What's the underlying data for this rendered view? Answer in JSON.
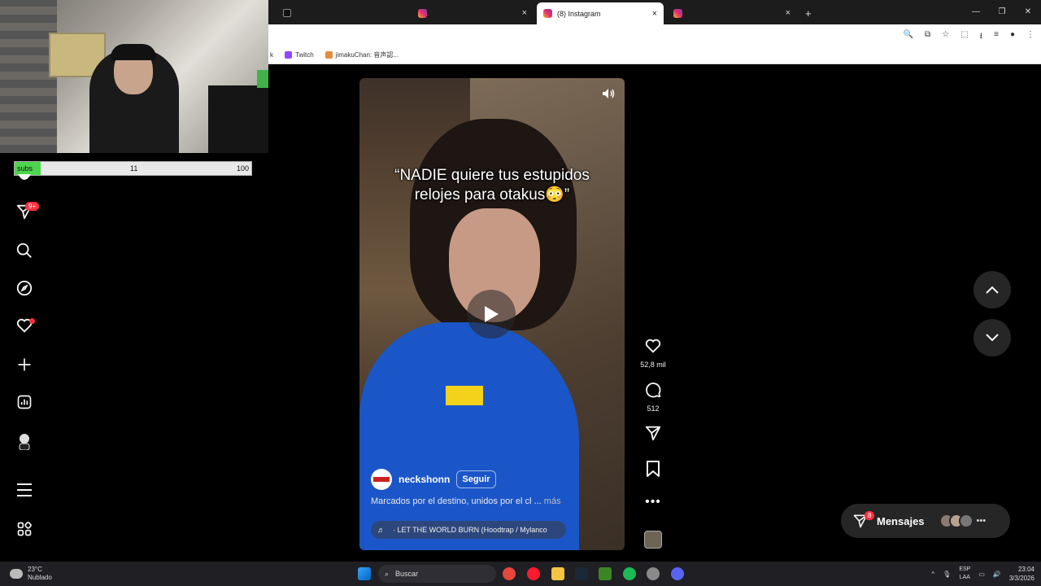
{
  "browser": {
    "tabs": [
      {
        "title": "",
        "icon": "tiktok-icon"
      },
      {
        "title": "",
        "icon": "instagram-icon"
      },
      {
        "title": "(8) Instagram",
        "icon": "instagram-icon",
        "active": true
      },
      {
        "title": "",
        "icon": "instagram-icon"
      }
    ],
    "bookmarks": [
      {
        "label": "Twitch"
      },
      {
        "label": "jimakuChan: 音声認..."
      }
    ]
  },
  "stream_overlay": {
    "subs_label": "subs",
    "subs_current": "11",
    "subs_goal": "100",
    "subs_progress": 0.11
  },
  "sidebar": {
    "notifications_badge": "9+"
  },
  "reel": {
    "caption": "“NADIE quiere tus estupidos relojes para otakus😳”",
    "author": "neckshonn",
    "follow_label": "Seguir",
    "description": "Marcados por el destino, unidos por el cl ...",
    "more_label": "más",
    "audio_track": "· LET THE WORLD BURN (Hoodtrap / Mylanco",
    "likes": "52,8 mil",
    "comments": "512"
  },
  "messages": {
    "label": "Mensajes",
    "badge": "8"
  },
  "taskbar": {
    "temperature": "23°C",
    "weather": "Nublado",
    "search_placeholder": "Buscar",
    "lang_top": "ESP",
    "lang_bottom": "LAA",
    "time": "23:04",
    "date": "3/3/2026"
  },
  "colors": {
    "badge_red": "#ff3040",
    "shirt_blue": "#1b56c9",
    "subs_green": "#4cd64c"
  }
}
